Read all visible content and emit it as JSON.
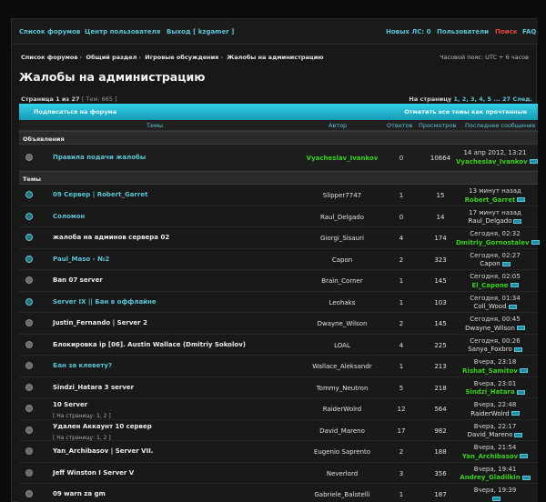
{
  "topnav": {
    "left": [
      "Список форумов",
      "Центр пользователя",
      "Выход [ kzgamer ]"
    ],
    "right": [
      "Новых ЛС: 0",
      "Пользователи",
      "Поиск",
      "FAQ"
    ]
  },
  "breadcrumbs": [
    "Список форумов",
    "Общий раздел",
    "Игровые обсуждения",
    "Жалобы на администрацию"
  ],
  "timezone": "Часовой пояс: UTC + 6 часов",
  "page_title": "Жалобы на администрацию",
  "pageinfo": {
    "pages": "Страница 1 из 27",
    "topics": "[ Тем: 665 ]"
  },
  "pager": {
    "label": "На страницу",
    "links": "1, 2, 3, 4, 5 ... 27",
    "next": "След."
  },
  "bar": {
    "subscribe": "Подписаться на форума",
    "mark_read": "Отметить все темы как прочтенные"
  },
  "columns": {
    "topics": "Темы",
    "author": "Автор",
    "replies": "Ответов",
    "views": "Просмотров",
    "last": "Последнее сообщение"
  },
  "sections": {
    "announcements": "Объявления",
    "topics": "Темы"
  },
  "announcement": {
    "title": "Правила подачи жалобы",
    "author": "Vyacheslav_Ivankov",
    "replies": "0",
    "views": "10664",
    "last_time": "14 апр 2012, 13:21",
    "last_user": "Vyacheslav_Ivankov"
  },
  "topics": [
    {
      "title": "09 Сервер | Robert_Garret",
      "author": "Slipper7747",
      "replies": "1",
      "views": "15",
      "last_time": "13 минут назад",
      "last_user": "Robert_Garret"
    },
    {
      "title": "Соломон",
      "author": "Raul_Delgado",
      "replies": "0",
      "views": "14",
      "last_time": "17 минут назад",
      "last_user": "Raul_Delgado"
    },
    {
      "title": "жалоба на админов сервера 02",
      "author": "Giorgi_Sisauri",
      "replies": "4",
      "views": "174",
      "last_time": "Сегодня, 02:32",
      "last_user": "Dmitriy_Gornostalev"
    },
    {
      "title": "Paul_Maso - №2",
      "author": "Capon",
      "replies": "2",
      "views": "323",
      "last_time": "Сегодня, 02:27",
      "last_user": "Capon"
    },
    {
      "title": "Ban 07 server",
      "author": "Brain_Corner",
      "replies": "1",
      "views": "145",
      "last_time": "Сегодня, 02:05",
      "last_user": "El_Capone"
    },
    {
      "title": "Server IX || Бан в оффлайне",
      "author": "Leohaks",
      "replies": "1",
      "views": "103",
      "last_time": "Сегодня, 01:34",
      "last_user": "Coll_Wood"
    },
    {
      "title": "Justin_Fernando | Server 2",
      "author": "Dwayne_Wilson",
      "replies": "2",
      "views": "145",
      "last_time": "Сегодня, 00:45",
      "last_user": "Dwayne_Wilson"
    },
    {
      "title": "Блокировка ip [06]. Austin Wallace (Dmitriy Sokolov)",
      "author": "LOAL",
      "replies": "4",
      "views": "225",
      "last_time": "Сегодня, 00:26",
      "last_user": "Sanya_Foxbro"
    },
    {
      "title": "Бан за клевету?",
      "author": "Wallace_Aleksandr",
      "replies": "1",
      "views": "213",
      "last_time": "Вчера, 23:18",
      "last_user": "Rishat_Samitov"
    },
    {
      "title": "Sindzi_Hatara 3 server",
      "author": "Tommy_Neutron",
      "replies": "5",
      "views": "218",
      "last_time": "Вчера, 23:01",
      "last_user": "Sindzi_Hatara"
    },
    {
      "title": "10 Server",
      "sub": "[ На страницу: 1, 2 ]",
      "author": "RaiderWolrd",
      "replies": "12",
      "views": "564",
      "last_time": "Вчера, 22:48",
      "last_user": "RaiderWolrd"
    },
    {
      "title": "Удален Аккаунт 10 сервер",
      "sub": "[ На страницу: 1, 2 ]",
      "author": "David_Mareno",
      "replies": "17",
      "views": "982",
      "last_time": "Вчера, 22:17",
      "last_user": "David_Mareno"
    },
    {
      "title": "Yan_Archibasov | Server VII.",
      "author": "Eugenio Saprento",
      "replies": "2",
      "views": "188",
      "last_time": "Вчера, 21:54",
      "last_user": "Yan_Archibasov"
    },
    {
      "title": "Jeff Winston I Server V",
      "author": "Neverlord",
      "replies": "3",
      "views": "356",
      "last_time": "Вчера, 19:41",
      "last_user": "Andrey_Gladilkin"
    },
    {
      "title": "09 warn za gm",
      "author": "Gabriele_Balotelli",
      "replies": "1",
      "views": "187",
      "last_time": "Вчера, 19:39",
      "last_user": ""
    }
  ],
  "colors": {
    "accent": "#5cc3d6",
    "bar": "#22b8d1",
    "green_user": "#39d11f",
    "red_link": "#e0483a"
  }
}
